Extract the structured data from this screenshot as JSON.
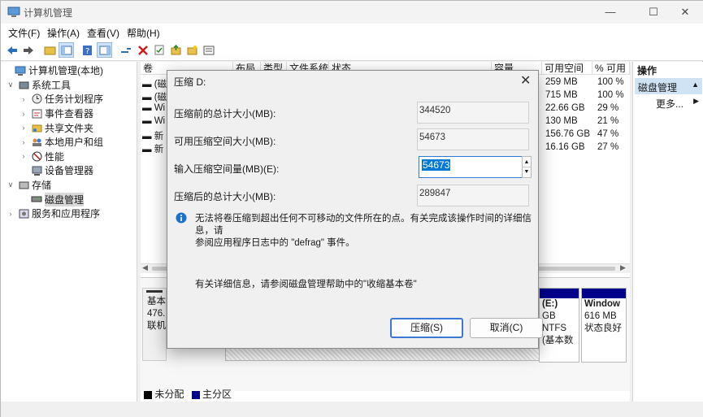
{
  "window": {
    "title": "计算机管理",
    "controls": {
      "minimize": "—",
      "maximize": "☐",
      "close": "✕"
    }
  },
  "menu": [
    "文件(F)",
    "操作(A)",
    "查看(V)",
    "帮助(H)"
  ],
  "tree": {
    "root": "计算机管理(本地)",
    "system_tools": "系统工具",
    "task_scheduler": "任务计划程序",
    "event_viewer": "事件查看器",
    "shared_folders": "共享文件夹",
    "local_users": "本地用户和组",
    "performance": "性能",
    "device_manager": "设备管理器",
    "storage": "存储",
    "disk_mgmt": "磁盘管理",
    "services_apps": "服务和应用程序"
  },
  "volume_table": {
    "headers": [
      "卷",
      "布局",
      "类型",
      "文件系统",
      "状态",
      "容量",
      "可用空间",
      "% 可用"
    ],
    "rows": [
      {
        "vol": "(磁",
        "free": "259 MB",
        "pct": "100 %"
      },
      {
        "vol": "(磁",
        "free": "715 MB",
        "pct": "100 %"
      },
      {
        "vol": "Wi",
        "free": "22.66 GB",
        "pct": "29 %"
      },
      {
        "vol": "Wi",
        "free": "130 MB",
        "pct": "21 %"
      },
      {
        "vol": "新",
        "free": "156.76 GB",
        "pct": "47 %"
      },
      {
        "vol": "新",
        "free": "16.16 GB",
        "pct": "27 %"
      }
    ]
  },
  "disk_map": {
    "left_lines": [
      "基本",
      "476.",
      "联机"
    ],
    "e_lines": [
      "(E:)",
      "GB NTFS",
      "(基本数"
    ],
    "win_lines": [
      "Window",
      "616 MB",
      "状态良好"
    ]
  },
  "legend": {
    "unallocated": "未分配",
    "primary": "主分区"
  },
  "actions": {
    "header": "操作",
    "section": "磁盘管理",
    "more": "更多..."
  },
  "dialog": {
    "title": "压缩 D:",
    "close": "✕",
    "total_before_label": "压缩前的总计大小(MB):",
    "total_before_value": "344520",
    "available_label": "可用压缩空间大小(MB):",
    "available_value": "54673",
    "enter_label": "输入压缩空间量(MB)(E):",
    "enter_value": "54673",
    "total_after_label": "压缩后的总计大小(MB):",
    "total_after_value": "289847",
    "info_text_1": "无法将卷压缩到超出任何不可移动的文件所在的点。有关完成该操作时间的详细信息，请",
    "info_text_2": "参阅应用程序日志中的 \"defrag\" 事件。",
    "help_text": "有关详细信息，请参阅磁盘管理帮助中的\"收缩基本卷\"",
    "shrink_button": "压缩(S)",
    "cancel_button": "取消(C)"
  },
  "colors": {
    "accent": "#0078d7",
    "primary_partition": "#00008b",
    "unallocated": "#000000"
  }
}
